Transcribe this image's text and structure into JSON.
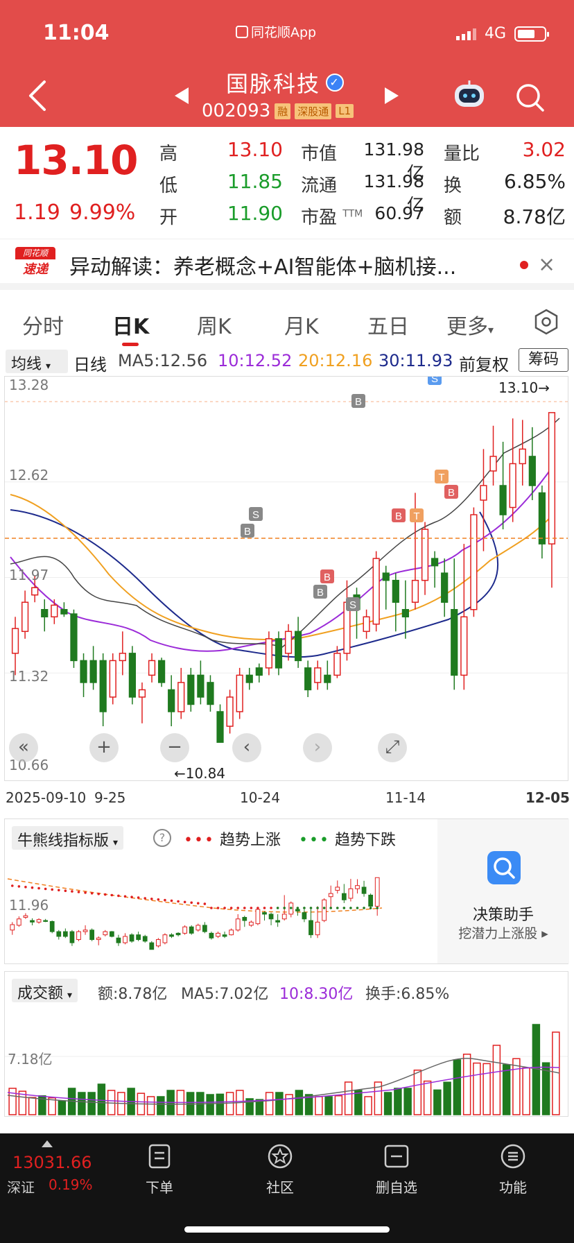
{
  "status_bar": {
    "time": "11:04",
    "app_label": "同花顺App",
    "network": "4G"
  },
  "header": {
    "stock_name": "国脉科技",
    "stock_code": "002093",
    "tags": [
      "融",
      "深股通",
      "L1"
    ]
  },
  "quote": {
    "price": "13.10",
    "change": "1.19",
    "change_pct": "9.99%",
    "high_label": "高",
    "high": "13.10",
    "low_label": "低",
    "low": "11.85",
    "open_label": "开",
    "open": "11.90",
    "mcap_label": "市值",
    "mcap": "131.98亿",
    "float_label": "流通",
    "float": "131.98亿",
    "pe_label": "市盈",
    "pe_suffix": "TTM",
    "pe": "60.97",
    "vol_ratio_label": "量比",
    "vol_ratio": "3.02",
    "turnover_label": "换",
    "turnover": "6.85%",
    "amount_label": "额",
    "amount": "8.78亿"
  },
  "notice": {
    "logo_top": "同花顺",
    "logo_bottom": "速递",
    "text": "异动解读：养老概念+AI智能体+脑机接..."
  },
  "tabs": [
    "分时",
    "日K",
    "周K",
    "月K",
    "五日",
    "更多"
  ],
  "ma_row": {
    "dropdown": "均线",
    "period": "日线",
    "ma5": "MA5:12.56",
    "ma10": "10:12.52",
    "ma20": "20:12.16",
    "ma30": "30:11.93",
    "adjust": "前复权",
    "chips": "筹码"
  },
  "chart_labels": {
    "y_ticks": [
      "13.28",
      "12.62",
      "11.97",
      "11.32",
      "10.66"
    ],
    "high_marker": "13.10→",
    "low_marker": "←10.84",
    "dates": [
      "2025-09-10",
      "9-25",
      "10-24",
      "11-14",
      "12-05"
    ]
  },
  "indicator": {
    "select": "牛熊线指标版",
    "legend_up": "趋势上涨",
    "legend_down": "趋势下跌",
    "y_tick": "11.96",
    "assistant_title": "决策助手",
    "assistant_sub": "挖潜力上涨股 ▸"
  },
  "volume": {
    "select": "成交额",
    "amount": "额:8.78亿",
    "ma5": "MA5:7.02亿",
    "ma10": "10:8.30亿",
    "turnover": "换手:6.85%",
    "y_tick": "7.18亿"
  },
  "bottom": {
    "index_value": "13031.66",
    "index_name": "深证",
    "index_pct": "0.19%",
    "nav": [
      "下单",
      "社区",
      "删自选",
      "功能"
    ]
  },
  "chart_data": {
    "type": "candlestick",
    "ylim": [
      10.66,
      13.28
    ],
    "candles": [
      [
        11.45,
        11.62,
        11.3,
        11.7
      ],
      [
        11.6,
        11.8,
        11.55,
        11.88
      ],
      [
        11.85,
        11.9,
        11.8,
        11.98
      ],
      [
        11.75,
        11.7,
        11.6,
        11.82
      ],
      [
        11.7,
        11.78,
        11.65,
        11.82
      ],
      [
        11.75,
        11.72,
        11.7,
        11.8
      ],
      [
        11.72,
        11.4,
        11.35,
        11.75
      ],
      [
        11.4,
        11.25,
        11.15,
        11.45
      ],
      [
        11.4,
        11.25,
        11.2,
        11.5
      ],
      [
        11.4,
        11.05,
        10.95,
        11.45
      ],
      [
        11.15,
        11.4,
        11.1,
        11.45
      ],
      [
        11.4,
        11.45,
        11.3,
        11.6
      ],
      [
        11.45,
        11.15,
        11.1,
        11.5
      ],
      [
        11.15,
        11.2,
        10.97,
        11.25
      ],
      [
        11.3,
        11.4,
        11.25,
        11.45
      ],
      [
        11.4,
        11.25,
        11.22,
        11.42
      ],
      [
        11.2,
        11.05,
        10.95,
        11.3
      ],
      [
        11.05,
        11.25,
        11.0,
        11.35
      ],
      [
        11.3,
        11.1,
        11.05,
        11.35
      ],
      [
        11.3,
        11.15,
        11.1,
        11.4
      ],
      [
        11.25,
        11.1,
        11.05,
        11.3
      ],
      [
        11.05,
        10.84,
        10.84,
        11.1
      ],
      [
        10.95,
        11.15,
        10.9,
        11.2
      ],
      [
        11.05,
        11.3,
        11.0,
        11.35
      ],
      [
        11.3,
        11.25,
        11.2,
        11.35
      ],
      [
        11.35,
        11.3,
        11.25,
        11.38
      ],
      [
        11.35,
        11.55,
        11.3,
        11.6
      ],
      [
        11.55,
        11.35,
        11.3,
        11.6
      ],
      [
        11.45,
        11.6,
        11.4,
        11.65
      ],
      [
        11.6,
        11.4,
        11.35,
        11.7
      ],
      [
        11.35,
        11.2,
        11.15,
        11.4
      ],
      [
        11.25,
        11.35,
        11.2,
        11.4
      ],
      [
        11.3,
        11.25,
        11.2,
        11.4
      ],
      [
        11.3,
        11.45,
        11.28,
        11.5
      ],
      [
        11.45,
        11.8,
        11.4,
        11.95
      ],
      [
        11.85,
        11.75,
        11.55,
        11.9
      ],
      [
        11.6,
        11.7,
        11.55,
        11.75
      ],
      [
        11.65,
        12.1,
        11.6,
        12.15
      ],
      [
        12.0,
        11.95,
        11.75,
        12.05
      ],
      [
        11.95,
        11.8,
        11.6,
        12.0
      ],
      [
        11.75,
        11.7,
        11.55,
        11.95
      ],
      [
        11.8,
        11.95,
        11.75,
        12.55
      ],
      [
        11.95,
        12.3,
        11.85,
        12.35
      ],
      [
        12.1,
        12.05,
        11.9,
        12.15
      ],
      [
        12.0,
        11.8,
        11.7,
        12.1
      ],
      [
        11.75,
        11.3,
        11.2,
        12.1
      ],
      [
        11.3,
        11.7,
        11.2,
        12.2
      ],
      [
        11.75,
        12.4,
        11.7,
        12.45
      ],
      [
        12.5,
        12.6,
        12.15,
        12.85
      ],
      [
        12.7,
        12.8,
        12.6,
        13.01
      ],
      [
        12.6,
        12.4,
        12.3,
        12.9
      ],
      [
        12.45,
        12.75,
        12.35,
        13.06
      ],
      [
        12.75,
        12.85,
        12.6,
        13.05
      ],
      [
        12.8,
        12.6,
        12.5,
        13.0
      ],
      [
        12.55,
        12.2,
        12.1,
        12.6
      ],
      [
        12.2,
        13.1,
        11.9,
        13.1
      ]
    ]
  }
}
